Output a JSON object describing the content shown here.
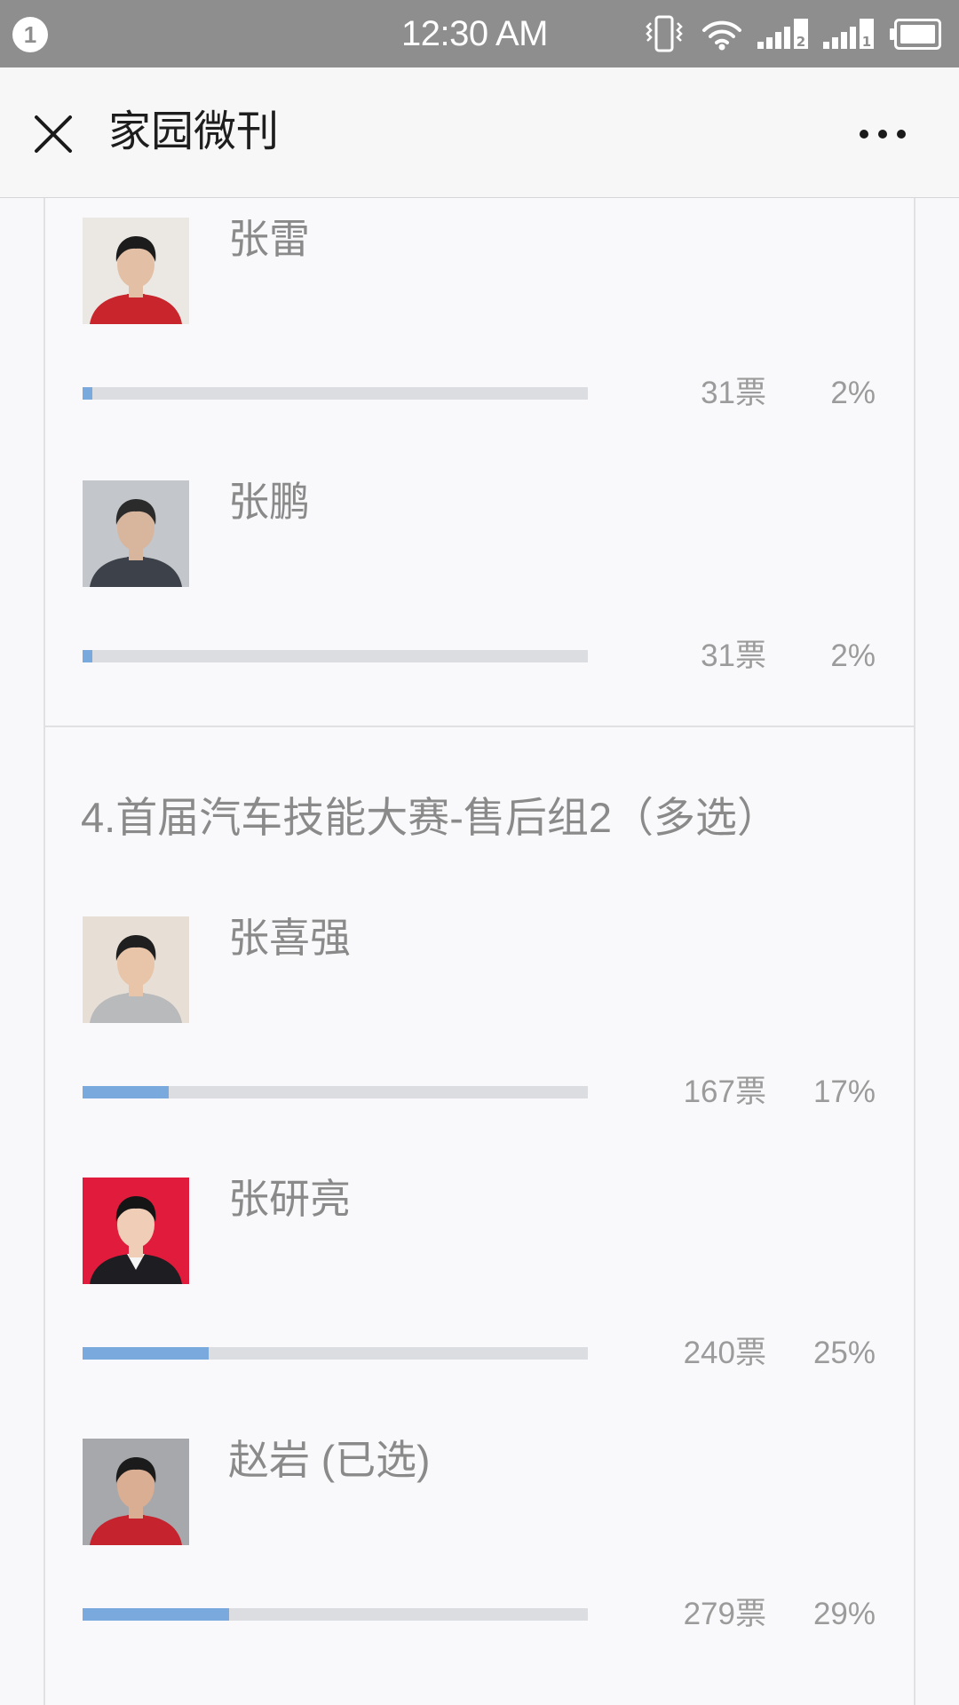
{
  "status_bar": {
    "notification_count": "1",
    "time": "12:30 AM",
    "sim2_label": "2",
    "sim1_label": "1",
    "icons": [
      "notification-badge",
      "vibrate-icon",
      "wifi-icon",
      "signal-sim2-icon",
      "signal-sim1-icon",
      "battery-icon"
    ]
  },
  "header": {
    "title": "家园微刊",
    "left_icon": "close-icon",
    "right_icon": "more-icon"
  },
  "poll": {
    "sections": [
      {
        "options": [
          {
            "name": "张雷",
            "votes": "31票",
            "percent_label": "2%",
            "percent": 2,
            "avatar": {
              "bg": "#ebe8e4",
              "clothes": "#c8262c",
              "skin": "#e3bfa5",
              "hair": "#1c1c1c"
            }
          },
          {
            "name": "张鹏",
            "votes": "31票",
            "percent_label": "2%",
            "percent": 2,
            "avatar": {
              "bg": "#c3c6ca",
              "clothes": "#3c414a",
              "skin": "#d8b59d",
              "hair": "#2b2b2b"
            }
          }
        ]
      },
      {
        "title": "4.首届汽车技能大赛-售后组2（多选）",
        "options": [
          {
            "name": "张喜强",
            "votes": "167票",
            "percent_label": "17%",
            "percent": 17,
            "avatar": {
              "bg": "#e7dfd6",
              "clothes": "#b9babc",
              "skin": "#e8c5a9",
              "hair": "#1f1f1f"
            }
          },
          {
            "name": "张研亮",
            "votes": "240票",
            "percent_label": "25%",
            "percent": 25,
            "avatar": {
              "bg": "#e11b3b",
              "clothes": "#1d1d22",
              "collar": "#f5f5f5",
              "skin": "#f0cdb6",
              "hair": "#151515"
            }
          },
          {
            "name": "赵岩",
            "selected_label": "(已选)",
            "votes": "279票",
            "percent_label": "29%",
            "percent": 29,
            "avatar": {
              "bg": "#a7a8ab",
              "clothes": "#c5232e",
              "skin": "#d9ae93",
              "hair": "#1b1b1b"
            }
          }
        ]
      }
    ]
  },
  "colors": {
    "status_bar": "#8e8e8e",
    "header_bg": "#f7f7f8",
    "page_bg": "#f8f8fa",
    "card_bg": "#f9f9fb",
    "border": "#e1e1e3",
    "title_text": "#1e1e1e",
    "muted_text": "#8a8a8a",
    "votes_text": "#9b9b9b",
    "bar_track": "#dcdde0",
    "bar_fill": "#7aa9dd"
  }
}
